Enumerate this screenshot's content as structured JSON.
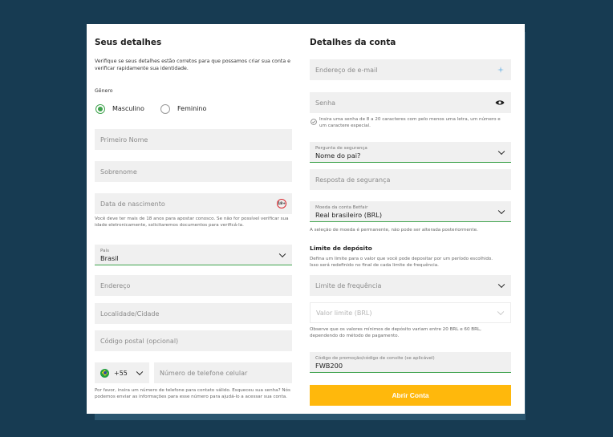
{
  "left": {
    "title": "Seus detalhes",
    "intro": "Verifique se seus detalhes estão corretos para que possamos criar sua conta e verificar rapidamente sua identidade.",
    "gender_label": "Gênero",
    "gender_options": [
      "Masculino",
      "Feminino"
    ],
    "first_name_placeholder": "Primeiro Nome",
    "last_name_placeholder": "Sobrenome",
    "dob_placeholder": "Data de nascimento",
    "age_badge": "18+",
    "age_note": "Você deve ter mais de 18 anos para apostar conosco. Se não for possível verificar sua idade eletronicamente, solicitaremos documentos para verificá-la.",
    "country_label": "País",
    "country_value": "Brasil",
    "address_placeholder": "Endereço",
    "city_placeholder": "Localidade/Cidade",
    "postal_placeholder": "Código postal (opcional)",
    "phone_code": "+55",
    "phone_placeholder": "Número de telefone celular",
    "phone_note": "Por favor, insira um número de telefone para contato válido. Esqueceu sua senha? Nós podemos enviar as informações para esse número para ajudá-lo a acessar sua conta."
  },
  "right": {
    "title": "Detalhes da conta",
    "email_placeholder": "Endereço de e-mail",
    "password_placeholder": "Senha",
    "password_hint": "Insira uma senha de 8 a 20 caracteres com pelo menos uma letra, um número e um caractere especial.",
    "security_question_label": "Pergunta de segurança",
    "security_question_value": "Nome do pai?",
    "security_answer_placeholder": "Resposta de segurança",
    "currency_label": "Moeda da conta Betfair",
    "currency_value": "Real brasileiro (BRL)",
    "currency_note": "A seleção de moeda é permanente, não pode ser alterada posteriormente.",
    "deposit_title": "Limite de depósito",
    "deposit_intro": "Defina um limite para o valor que você pode depositar por um período escolhido. Isso será redefinido no final de cada limite de frequência.",
    "frequency_placeholder": "Limite de frequência",
    "limit_value_placeholder": "Valor limite (BRL)",
    "deposit_note": "Observe que os valores mínimos de depósito variam entre 20 BRL e 60 BRL, dependendo do método de pagamento.",
    "promo_label": "Código de promoção/código de convite (se aplicável)",
    "promo_value": "FWB200",
    "submit_label": "Abrir Conta"
  },
  "colors": {
    "background": "#173b52",
    "accent_green": "#3fa34d",
    "submit_yellow": "#ffb80c"
  }
}
